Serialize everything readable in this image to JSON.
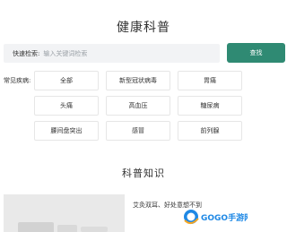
{
  "page_title": "健康科普",
  "search": {
    "label": "快速检索:",
    "placeholder": "输入关键词检索",
    "value": "",
    "button_label": "查找"
  },
  "diseases": {
    "label": "常见疾病:",
    "tags": [
      "全部",
      "新型冠状病毒",
      "胃痛",
      "头痛",
      "高血压",
      "糖尿病",
      "腰间盘突出",
      "感冒",
      "前列腺"
    ]
  },
  "knowledge": {
    "section_title": "科普知识",
    "card_caption": "艾灸双耳、好处意想不到"
  },
  "logo": {
    "text": "GOGO手游网",
    "brand_color": "#1e88e5",
    "accent_color": "#f5a623"
  },
  "colors": {
    "accent": "#2f8a73",
    "search_bg": "#f2f3f5",
    "tag_border": "#e6e6e6"
  }
}
